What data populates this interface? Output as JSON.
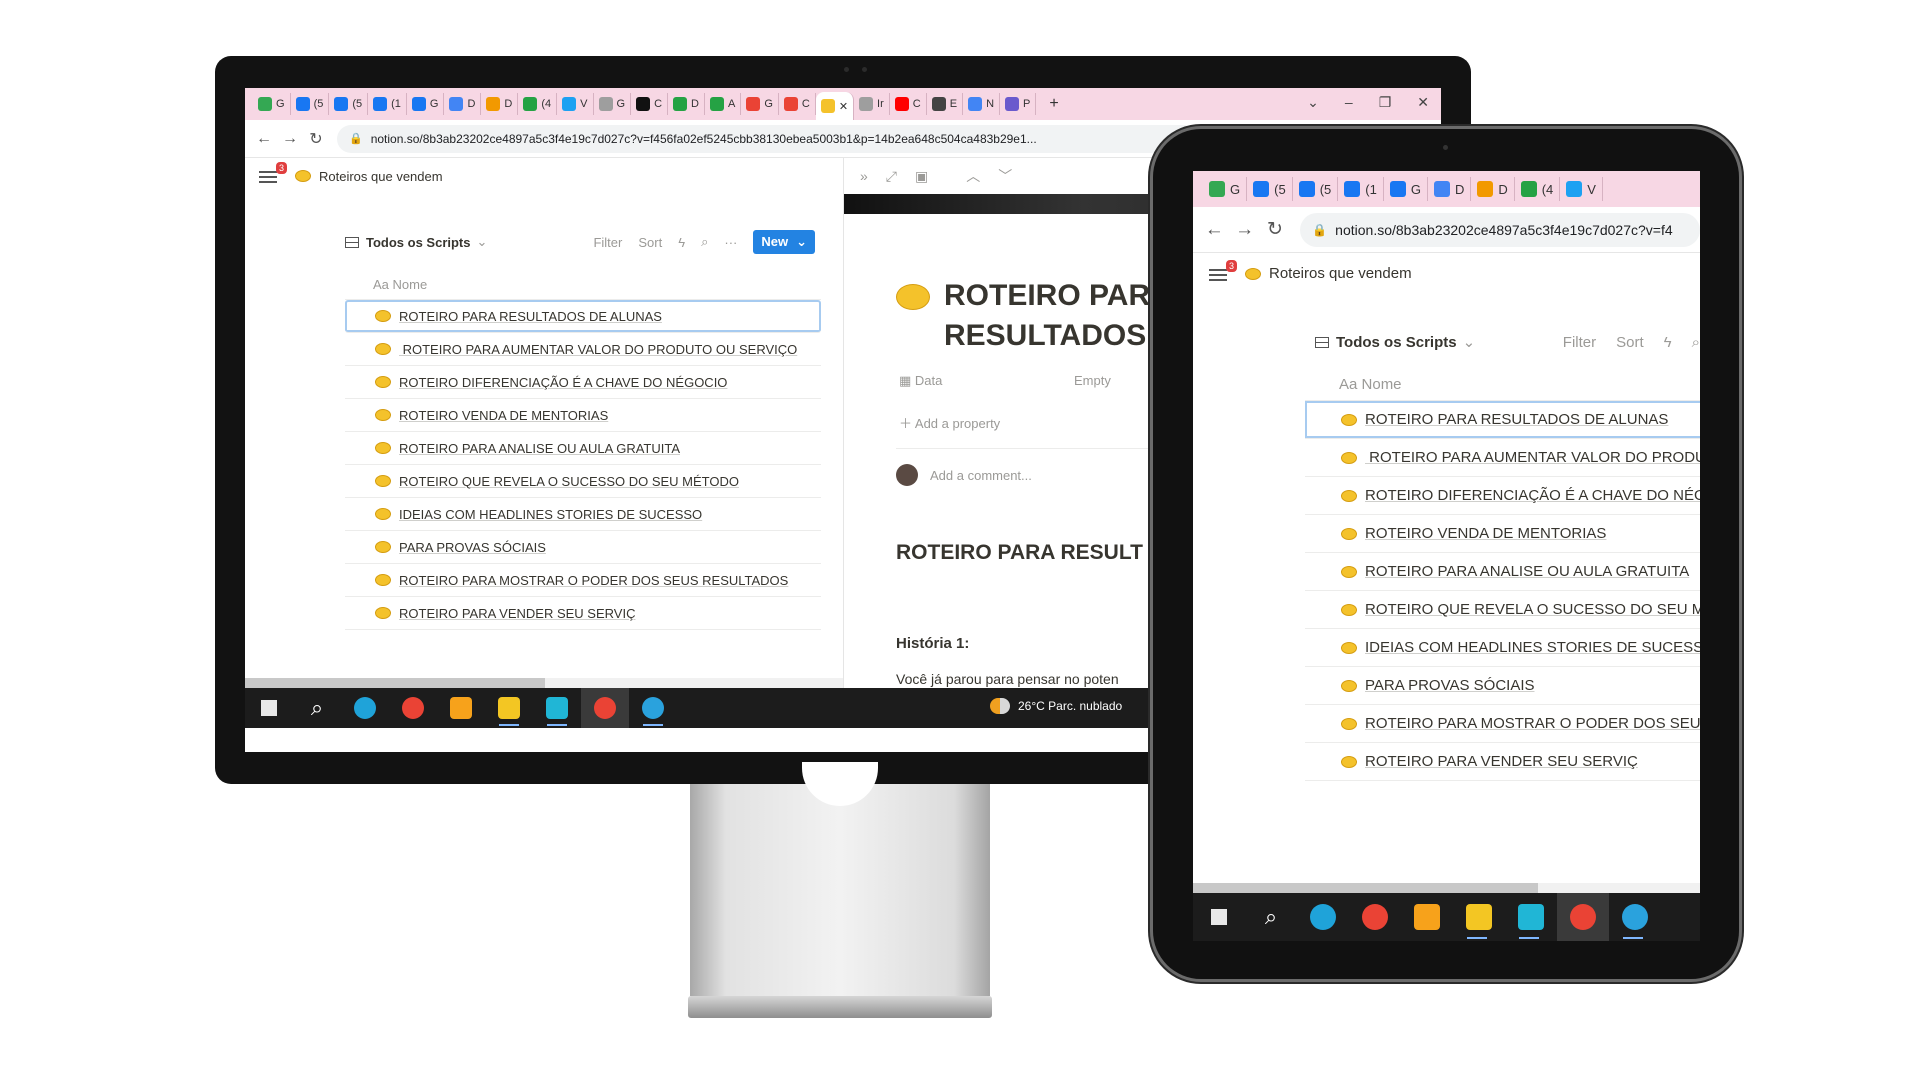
{
  "browser": {
    "tabs": [
      {
        "label": "G",
        "color": "#34a853"
      },
      {
        "label": "(5",
        "color": "#1877f2"
      },
      {
        "label": "(5",
        "color": "#1877f2"
      },
      {
        "label": "(1",
        "color": "#1877f2"
      },
      {
        "label": "G",
        "color": "#1877f2"
      },
      {
        "label": "D",
        "color": "#4285f4"
      },
      {
        "label": "D",
        "color": "#f29900"
      },
      {
        "label": "(4",
        "color": "#25a244"
      },
      {
        "label": "V",
        "color": "#1da1f2"
      },
      {
        "label": "G",
        "color": "#9e9e9e"
      },
      {
        "label": "C",
        "color": "#111111"
      },
      {
        "label": "D",
        "color": "#25a244"
      },
      {
        "label": "A",
        "color": "#25a244"
      },
      {
        "label": "G",
        "color": "#ea4335"
      },
      {
        "label": "C",
        "color": "#ea4335"
      },
      {
        "label": "✕",
        "color": "#f4c22b"
      },
      {
        "label": "Ir",
        "color": "#9e9e9e"
      },
      {
        "label": "C",
        "color": "#ff0000"
      },
      {
        "label": "E",
        "color": "#444444"
      },
      {
        "label": "N",
        "color": "#4285f4"
      },
      {
        "label": "P",
        "color": "#6a5acd"
      }
    ],
    "new_tab": "+",
    "url": "notion.so/8b3ab23202ce4897a5c3f4e19c7d027c?v=f456fa02ef5245cbb38130ebea5003b1&p=14b2ea648c504ca483b29e1..."
  },
  "tablet_browser": {
    "tabs": [
      {
        "label": "G",
        "color": "#34a853"
      },
      {
        "label": "(5",
        "color": "#1877f2"
      },
      {
        "label": "(5",
        "color": "#1877f2"
      },
      {
        "label": "(1",
        "color": "#1877f2"
      },
      {
        "label": "G",
        "color": "#1877f2"
      },
      {
        "label": "D",
        "color": "#4285f4"
      },
      {
        "label": "D",
        "color": "#f29900"
      },
      {
        "label": "(4",
        "color": "#25a244"
      },
      {
        "label": "V",
        "color": "#1da1f2"
      }
    ],
    "url": "notion.so/8b3ab23202ce4897a5c3f4e19c7d027c?v=f4"
  },
  "notion": {
    "breadcrumb": "Roteiros que vendem",
    "badge": "3",
    "view_name": "Todos os Scripts",
    "filter": "Filter",
    "sort": "Sort",
    "new_label": "New",
    "column_header": "Aa Nome",
    "rows": [
      "ROTEIRO PARA RESULTADOS DE ALUNAS",
      " ROTEIRO PARA AUMENTAR VALOR DO PRODUTO OU SERVIÇO",
      "ROTEIRO DIFERENCIAÇÃO É A CHAVE DO NÉGOCIO",
      "ROTEIRO VENDA DE MENTORIAS",
      "ROTEIRO PARA ANALISE OU AULA GRATUITA",
      "ROTEIRO QUE REVELA O SUCESSO DO SEU MÉTODO",
      "IDEIAS COM HEADLINES STORIES DE SUCESSO",
      "PARA PROVAS SÓCIAIS",
      "ROTEIRO PARA MOSTRAR O PODER DOS SEUS RESULTADOS",
      "ROTEIRO PARA VENDER SEU SERVIÇ"
    ]
  },
  "peek": {
    "title_line1": "ROTEIRO PAR",
    "title_line2": "RESULTADOS",
    "property_name": "Data",
    "property_value": "Empty",
    "add_property": "Add a property",
    "add_comment": "Add a comment...",
    "heading": "ROTEIRO PARA RESULT",
    "subheading": "História 1:",
    "paragraph": "Você já parou para pensar no poten"
  },
  "taskbar": {
    "weather": "26°C  Parc. nublado",
    "icons": [
      {
        "name": "windows-start-icon",
        "color": "#3a96dd"
      },
      {
        "name": "search-icon",
        "color": "#ffffff"
      },
      {
        "name": "edge-icon",
        "color": "#1fa3d9"
      },
      {
        "name": "chrome-icon",
        "color": "#ea4335"
      },
      {
        "name": "media-player-icon",
        "color": "#f7a21b"
      },
      {
        "name": "file-explorer-icon",
        "color": "#f3c623"
      },
      {
        "name": "download-app-icon",
        "color": "#20b6d6"
      },
      {
        "name": "chrome-profile-icon",
        "color": "#ea4335"
      },
      {
        "name": "telegram-icon",
        "color": "#2aa2dd"
      }
    ]
  }
}
